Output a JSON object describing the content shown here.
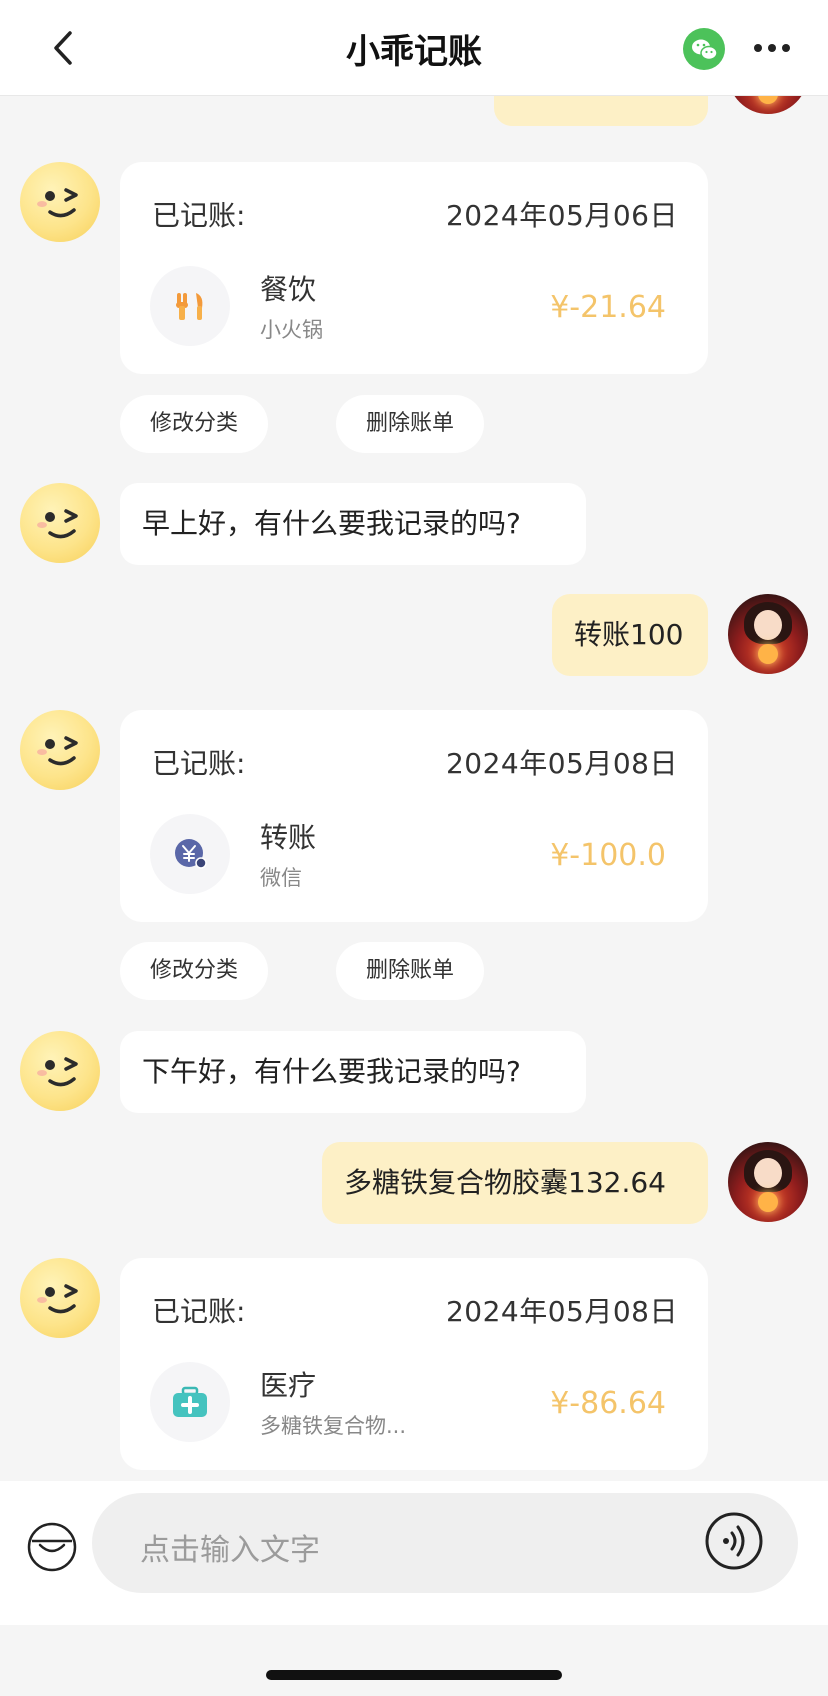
{
  "header": {
    "title": "小乖记账"
  },
  "messages": {
    "card1": {
      "label": "已记账:",
      "date": "2024年05月06日",
      "category": "餐饮",
      "note": "小火锅",
      "amount": "¥-21.64"
    },
    "card1_actions": {
      "edit": "修改分类",
      "delete": "删除账单"
    },
    "greet1": "早上好，有什么要我记录的吗?",
    "user1": "转账100",
    "card2": {
      "label": "已记账:",
      "date": "2024年05月08日",
      "category": "转账",
      "note": "微信",
      "amount": "¥-100.0"
    },
    "card2_actions": {
      "edit": "修改分类",
      "delete": "删除账单"
    },
    "greet2": "下午好，有什么要我记录的吗?",
    "user2": "多糖铁复合物胶囊132.64",
    "card3": {
      "label": "已记账:",
      "date": "2024年05月08日",
      "category": "医疗",
      "note": "多糖铁复合物...",
      "amount": "¥-86.64"
    }
  },
  "input": {
    "placeholder": "点击输入文字"
  },
  "colors": {
    "amount": "#f4c46a",
    "user_bubble": "#fdf0c6",
    "wechat": "#4cc25a"
  },
  "icons": [
    "back-arrow-icon",
    "wechat-icon",
    "more-icon",
    "smiley-bot-icon",
    "fork-knife-icon",
    "yuan-transfer-icon",
    "medical-kit-icon",
    "quick-panel-icon",
    "voice-icon"
  ]
}
